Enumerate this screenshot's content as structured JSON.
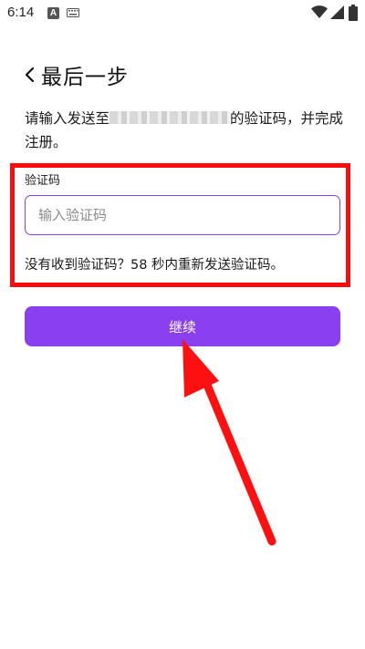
{
  "status_bar": {
    "time": "6:14",
    "notification_letter": "A",
    "icons": [
      "a-notification-icon",
      "keyboard-icon",
      "wifi-icon",
      "signal-icon",
      "battery-icon"
    ]
  },
  "header": {
    "back_icon": "chevron-left-icon",
    "title": "最后一步"
  },
  "instruction": {
    "prefix": "请输入发送至",
    "suffix": "的验证码，并完成注册。"
  },
  "code_field": {
    "label": "验证码",
    "value": "",
    "placeholder": "输入验证码"
  },
  "resend_hint": "没有收到验证码？58 秒内重新发送验证码。",
  "continue_button": {
    "label": "继续"
  },
  "colors": {
    "accent": "#8a3ff0",
    "annotation": "#ff0a0a"
  }
}
